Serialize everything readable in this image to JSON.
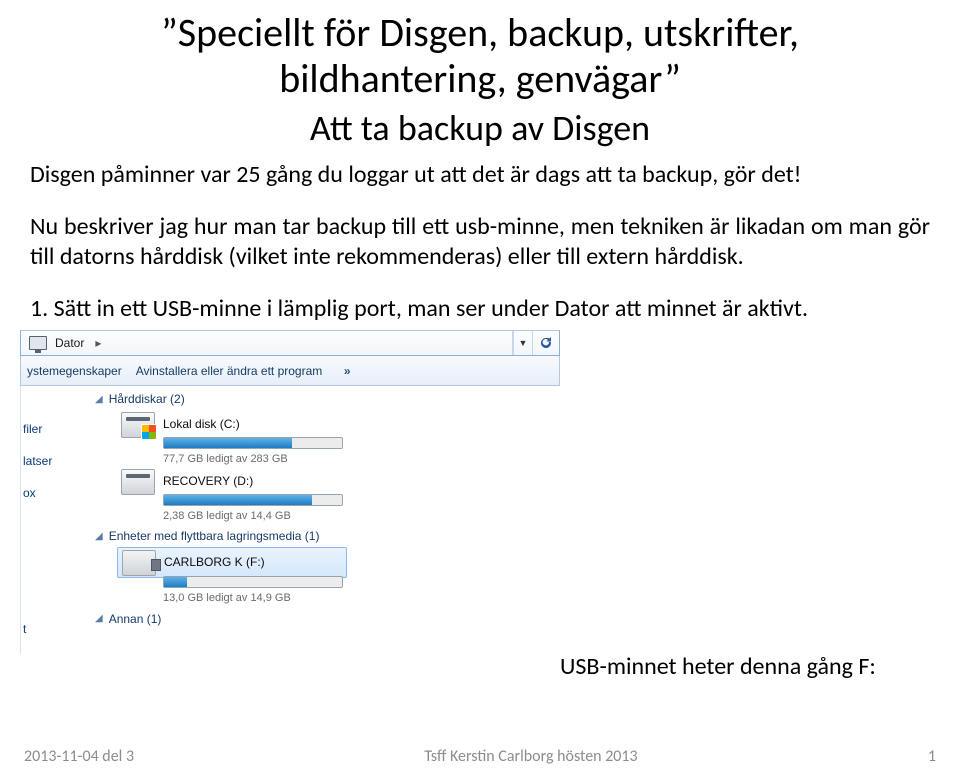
{
  "title_line1": "”Speciellt för Disgen, backup, utskrifter,",
  "title_line2": "bildhantering, genvägar”",
  "subtitle": "Att ta backup av Disgen",
  "para1": "Disgen påminner var 25 gång du loggar ut att det är dags att ta backup, gör det!",
  "para2": "Nu beskriver jag hur man tar backup till ett usb-minne, men tekniken är likadan om man gör till datorns hårddisk (vilket inte rekommenderas) eller till extern hårddisk.",
  "para3": "1. Sätt in ett USB-minne i lämplig port, man ser under Dator att minnet är aktivt.",
  "breadcrumb": {
    "label": "Dator",
    "chevron": "▸"
  },
  "toolbar": {
    "item1": "ystemegenskaper",
    "item2": "Avinstallera eller ändra ett program",
    "more": "»"
  },
  "nav": {
    "i1": "filer",
    "i2": "latser",
    "i3": "ox",
    "i4": "t"
  },
  "groups": {
    "hdd": "Hårddiskar (2)",
    "removable": "Enheter med flyttbara lagringsmedia (1)",
    "other": "Annan (1)"
  },
  "drives": {
    "c": {
      "name": "Lokal disk (C:)",
      "free": "77,7 GB ledigt av 283 GB",
      "fill": 72
    },
    "d": {
      "name": "RECOVERY (D:)",
      "free": "2,38 GB ledigt av 14,4 GB",
      "fill": 83
    },
    "f": {
      "name": "CARLBORG K (F:)",
      "free": "13,0 GB ledigt av 14,9 GB",
      "fill": 13
    }
  },
  "caption": "USB-minnet heter denna gång F:",
  "footer": {
    "left": "2013-11-04 del 3",
    "center": "Tsff Kerstin Carlborg hösten 2013",
    "right": "1"
  }
}
